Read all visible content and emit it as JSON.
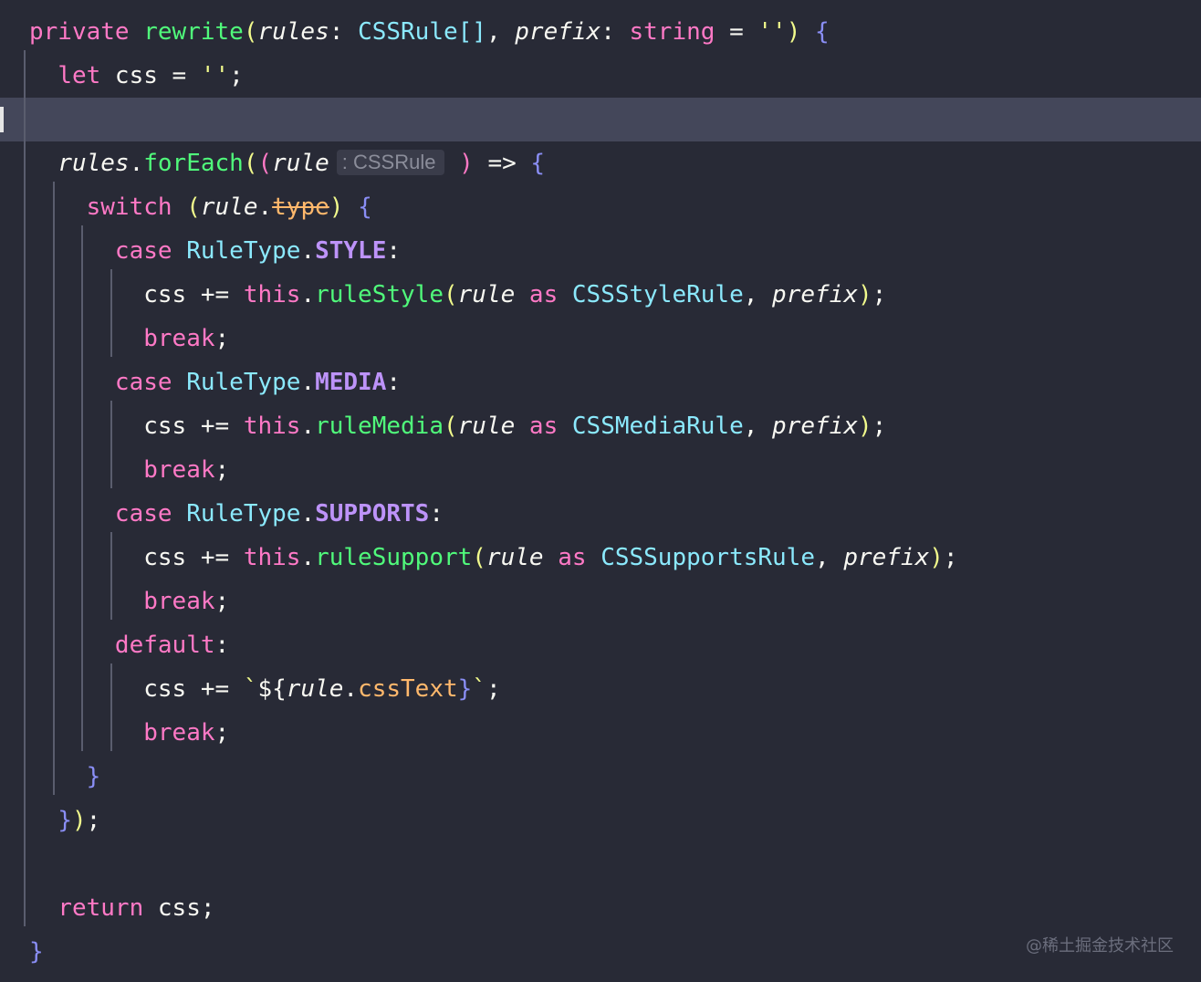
{
  "editor": {
    "theme_colors": {
      "background": "#282a36",
      "current_line": "#44475a",
      "keyword": "#ff79c6",
      "function": "#50fa7b",
      "type": "#8be9fd",
      "property": "#bd93f9",
      "string": "#f1fa8c",
      "member": "#ffb86c"
    },
    "lines": [
      [
        {
          "t": "private",
          "c": "kw"
        },
        {
          "t": " "
        },
        {
          "t": "rewrite",
          "c": "fn"
        },
        {
          "t": "(",
          "c": "br1"
        },
        {
          "t": "rules",
          "c": "param"
        },
        {
          "t": ": "
        },
        {
          "t": "CSSRule",
          "c": "type"
        },
        {
          "t": "[]",
          "c": "type"
        },
        {
          "t": ", "
        },
        {
          "t": "prefix",
          "c": "param"
        },
        {
          "t": ": "
        },
        {
          "t": "string",
          "c": "kw"
        },
        {
          "t": " = "
        },
        {
          "t": "''",
          "c": "str"
        },
        {
          "t": ")",
          "c": "br1"
        },
        {
          "t": " "
        },
        {
          "t": "{",
          "c": "curly"
        }
      ],
      [
        {
          "t": "  "
        },
        {
          "t": "let",
          "c": "kw"
        },
        {
          "t": " css = "
        },
        {
          "t": "''",
          "c": "str"
        },
        {
          "t": ";"
        }
      ],
      [],
      [
        {
          "t": "  "
        },
        {
          "t": "rules",
          "c": "param"
        },
        {
          "t": "."
        },
        {
          "t": "forEach",
          "c": "fn"
        },
        {
          "t": "(",
          "c": "br1"
        },
        {
          "t": "(",
          "c": "br2"
        },
        {
          "t": "rule",
          "c": "param"
        },
        {
          "hint": ": CSSRule"
        },
        {
          "t": " "
        },
        {
          "t": ")",
          "c": "br2"
        },
        {
          "t": " => "
        },
        {
          "t": "{",
          "c": "curly"
        }
      ],
      [
        {
          "t": "    "
        },
        {
          "t": "switch",
          "c": "kw"
        },
        {
          "t": " "
        },
        {
          "t": "(",
          "c": "br1"
        },
        {
          "t": "rule",
          "c": "param"
        },
        {
          "t": "."
        },
        {
          "t": "type",
          "c": "deprecated"
        },
        {
          "t": ")",
          "c": "br1"
        },
        {
          "t": " "
        },
        {
          "t": "{",
          "c": "curly"
        }
      ],
      [
        {
          "t": "      "
        },
        {
          "t": "case",
          "c": "kw"
        },
        {
          "t": " "
        },
        {
          "t": "RuleType",
          "c": "type"
        },
        {
          "t": "."
        },
        {
          "t": "STYLE",
          "c": "prop"
        },
        {
          "t": ":"
        }
      ],
      [
        {
          "t": "        css += "
        },
        {
          "t": "this",
          "c": "kw"
        },
        {
          "t": "."
        },
        {
          "t": "ruleStyle",
          "c": "fn"
        },
        {
          "t": "(",
          "c": "br1"
        },
        {
          "t": "rule",
          "c": "param"
        },
        {
          "t": " "
        },
        {
          "t": "as",
          "c": "kw"
        },
        {
          "t": " "
        },
        {
          "t": "CSSStyleRule",
          "c": "type"
        },
        {
          "t": ", "
        },
        {
          "t": "prefix",
          "c": "param"
        },
        {
          "t": ")",
          "c": "br1"
        },
        {
          "t": ";"
        }
      ],
      [
        {
          "t": "        "
        },
        {
          "t": "break",
          "c": "kw"
        },
        {
          "t": ";"
        }
      ],
      [
        {
          "t": "      "
        },
        {
          "t": "case",
          "c": "kw"
        },
        {
          "t": " "
        },
        {
          "t": "RuleType",
          "c": "type"
        },
        {
          "t": "."
        },
        {
          "t": "MEDIA",
          "c": "prop"
        },
        {
          "t": ":"
        }
      ],
      [
        {
          "t": "        css += "
        },
        {
          "t": "this",
          "c": "kw"
        },
        {
          "t": "."
        },
        {
          "t": "ruleMedia",
          "c": "fn"
        },
        {
          "t": "(",
          "c": "br1"
        },
        {
          "t": "rule",
          "c": "param"
        },
        {
          "t": " "
        },
        {
          "t": "as",
          "c": "kw"
        },
        {
          "t": " "
        },
        {
          "t": "CSSMediaRule",
          "c": "type"
        },
        {
          "t": ", "
        },
        {
          "t": "prefix",
          "c": "param"
        },
        {
          "t": ")",
          "c": "br1"
        },
        {
          "t": ";"
        }
      ],
      [
        {
          "t": "        "
        },
        {
          "t": "break",
          "c": "kw"
        },
        {
          "t": ";"
        }
      ],
      [
        {
          "t": "      "
        },
        {
          "t": "case",
          "c": "kw"
        },
        {
          "t": " "
        },
        {
          "t": "RuleType",
          "c": "type"
        },
        {
          "t": "."
        },
        {
          "t": "SUPPORTS",
          "c": "prop"
        },
        {
          "t": ":"
        }
      ],
      [
        {
          "t": "        css += "
        },
        {
          "t": "this",
          "c": "kw"
        },
        {
          "t": "."
        },
        {
          "t": "ruleSupport",
          "c": "fn"
        },
        {
          "t": "(",
          "c": "br1"
        },
        {
          "t": "rule",
          "c": "param"
        },
        {
          "t": " "
        },
        {
          "t": "as",
          "c": "kw"
        },
        {
          "t": " "
        },
        {
          "t": "CSSSupportsRule",
          "c": "type"
        },
        {
          "t": ", "
        },
        {
          "t": "prefix",
          "c": "param"
        },
        {
          "t": ")",
          "c": "br1"
        },
        {
          "t": ";"
        }
      ],
      [
        {
          "t": "        "
        },
        {
          "t": "break",
          "c": "kw"
        },
        {
          "t": ";"
        }
      ],
      [
        {
          "t": "      "
        },
        {
          "t": "default",
          "c": "kw"
        },
        {
          "t": ":"
        }
      ],
      [
        {
          "t": "        css += "
        },
        {
          "t": "`",
          "c": "str"
        },
        {
          "t": "${",
          "c": "plain"
        },
        {
          "t": "rule",
          "c": "param"
        },
        {
          "t": "."
        },
        {
          "t": "cssText",
          "c": "member"
        },
        {
          "t": "}",
          "c": "curly"
        },
        {
          "t": "`",
          "c": "str"
        },
        {
          "t": ";"
        }
      ],
      [
        {
          "t": "        "
        },
        {
          "t": "break",
          "c": "kw"
        },
        {
          "t": ";"
        }
      ],
      [
        {
          "t": "    "
        },
        {
          "t": "}",
          "c": "curly"
        }
      ],
      [
        {
          "t": "  "
        },
        {
          "t": "}",
          "c": "curly"
        },
        {
          "t": ")",
          "c": "br1"
        },
        {
          "t": ";"
        }
      ],
      [],
      [
        {
          "t": "  "
        },
        {
          "t": "return",
          "c": "kw"
        },
        {
          "t": " css;"
        }
      ],
      [
        {
          "t": "}",
          "c": "curly"
        }
      ]
    ],
    "current_line_index": 2
  },
  "watermark": "@稀土掘金技术社区"
}
